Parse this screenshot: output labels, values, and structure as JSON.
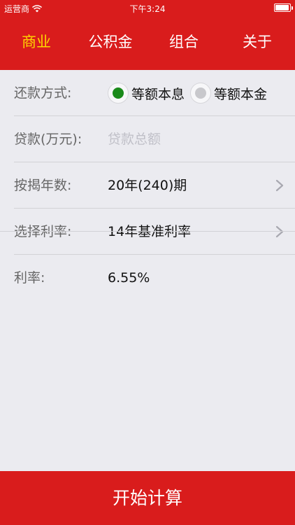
{
  "status": {
    "carrier": "运营商",
    "time": "下午3:24",
    "wifi_icon": "wifi-icon",
    "battery_icon": "battery-icon"
  },
  "colors": {
    "brand_red": "#d91c1c",
    "active_tab": "#ffd700",
    "radio_selected": "#1a8a1a",
    "radio_unselected": "#c8c8cc",
    "background": "#ebebf0"
  },
  "tabs": [
    {
      "label": "商业",
      "active": true
    },
    {
      "label": "公积金",
      "active": false
    },
    {
      "label": "组合",
      "active": false
    },
    {
      "label": "关于",
      "active": false
    }
  ],
  "form": {
    "repayment": {
      "label": "还款方式:",
      "options": [
        {
          "label": "等额本息",
          "selected": true
        },
        {
          "label": "等额本金",
          "selected": false
        }
      ]
    },
    "loan": {
      "label": "贷款(万元):",
      "value": "",
      "placeholder": "贷款总额"
    },
    "years": {
      "label": "按揭年数:",
      "value": "20年(240)期"
    },
    "rate_select": {
      "label": "选择利率:",
      "value": "14年基准利率"
    },
    "rate": {
      "label": "利率:",
      "value": "6.55%"
    }
  },
  "action": {
    "calculate_label": "开始计算"
  }
}
